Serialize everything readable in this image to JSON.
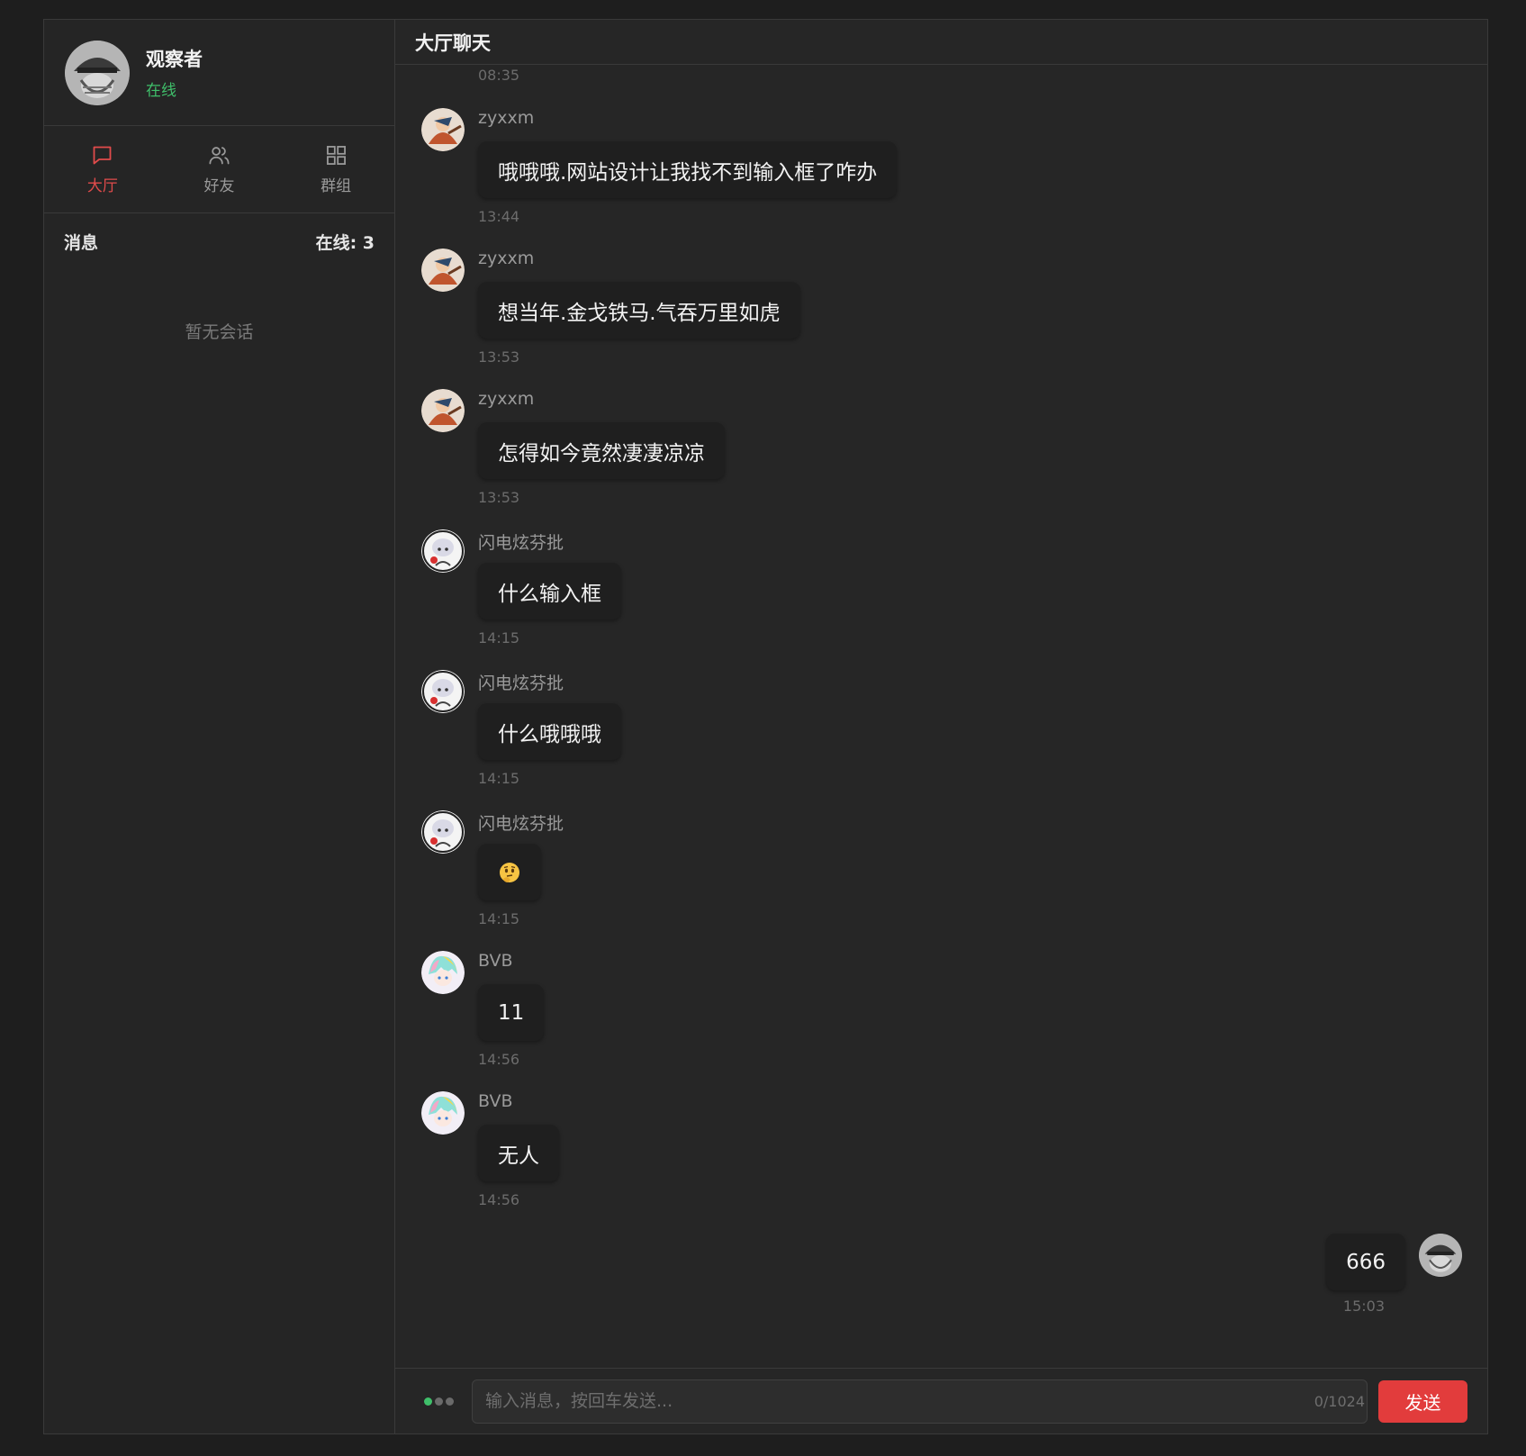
{
  "profile": {
    "name": "观察者",
    "status": "在线",
    "status_color": "#3fbf6a"
  },
  "nav": [
    {
      "label": "大厅",
      "icon": "chat-bubble-icon",
      "active": true
    },
    {
      "label": "好友",
      "icon": "users-icon",
      "active": false
    },
    {
      "label": "群组",
      "icon": "grid-icon",
      "active": false
    }
  ],
  "sessions": {
    "title": "消息",
    "online": "在线: 3",
    "empty": "暂无会话"
  },
  "chat": {
    "title": "大厅聊天",
    "first_time": "08:35",
    "messages": [
      {
        "sender": "zyxxm",
        "text": "哦哦哦.网站设计让我找不到输入框了咋办",
        "time": "13:44",
        "avatar": "zyxxm-avatar"
      },
      {
        "sender": "zyxxm",
        "text": "想当年.金戈铁马.气吞万里如虎",
        "time": "13:53",
        "avatar": "zyxxm-avatar"
      },
      {
        "sender": "zyxxm",
        "text": "怎得如今竟然凄凄凉凉",
        "time": "13:53",
        "avatar": "zyxxm-avatar"
      },
      {
        "sender": "闪电炫芬批",
        "text": "什么输入框",
        "time": "14:15",
        "avatar": "anime-girl-avatar"
      },
      {
        "sender": "闪电炫芬批",
        "text": "什么哦哦哦",
        "time": "14:15",
        "avatar": "anime-girl-avatar"
      },
      {
        "sender": "闪电炫芬批",
        "text": "",
        "emoji": "thinking-face-emoji",
        "time": "14:15",
        "avatar": "anime-girl-avatar"
      },
      {
        "sender": "BVB",
        "text": "11",
        "time": "14:56",
        "avatar": "colorful-girl-avatar"
      },
      {
        "sender": "BVB",
        "text": "无人",
        "time": "14:56",
        "avatar": "colorful-girl-avatar"
      }
    ],
    "mine": {
      "text": "666",
      "time": "15:03"
    }
  },
  "composer": {
    "placeholder": "输入消息，按回车发送...",
    "counter": "0/1024",
    "send_label": "发送"
  },
  "colors": {
    "accent": "#e23c3c",
    "online": "#3fbf6a"
  }
}
